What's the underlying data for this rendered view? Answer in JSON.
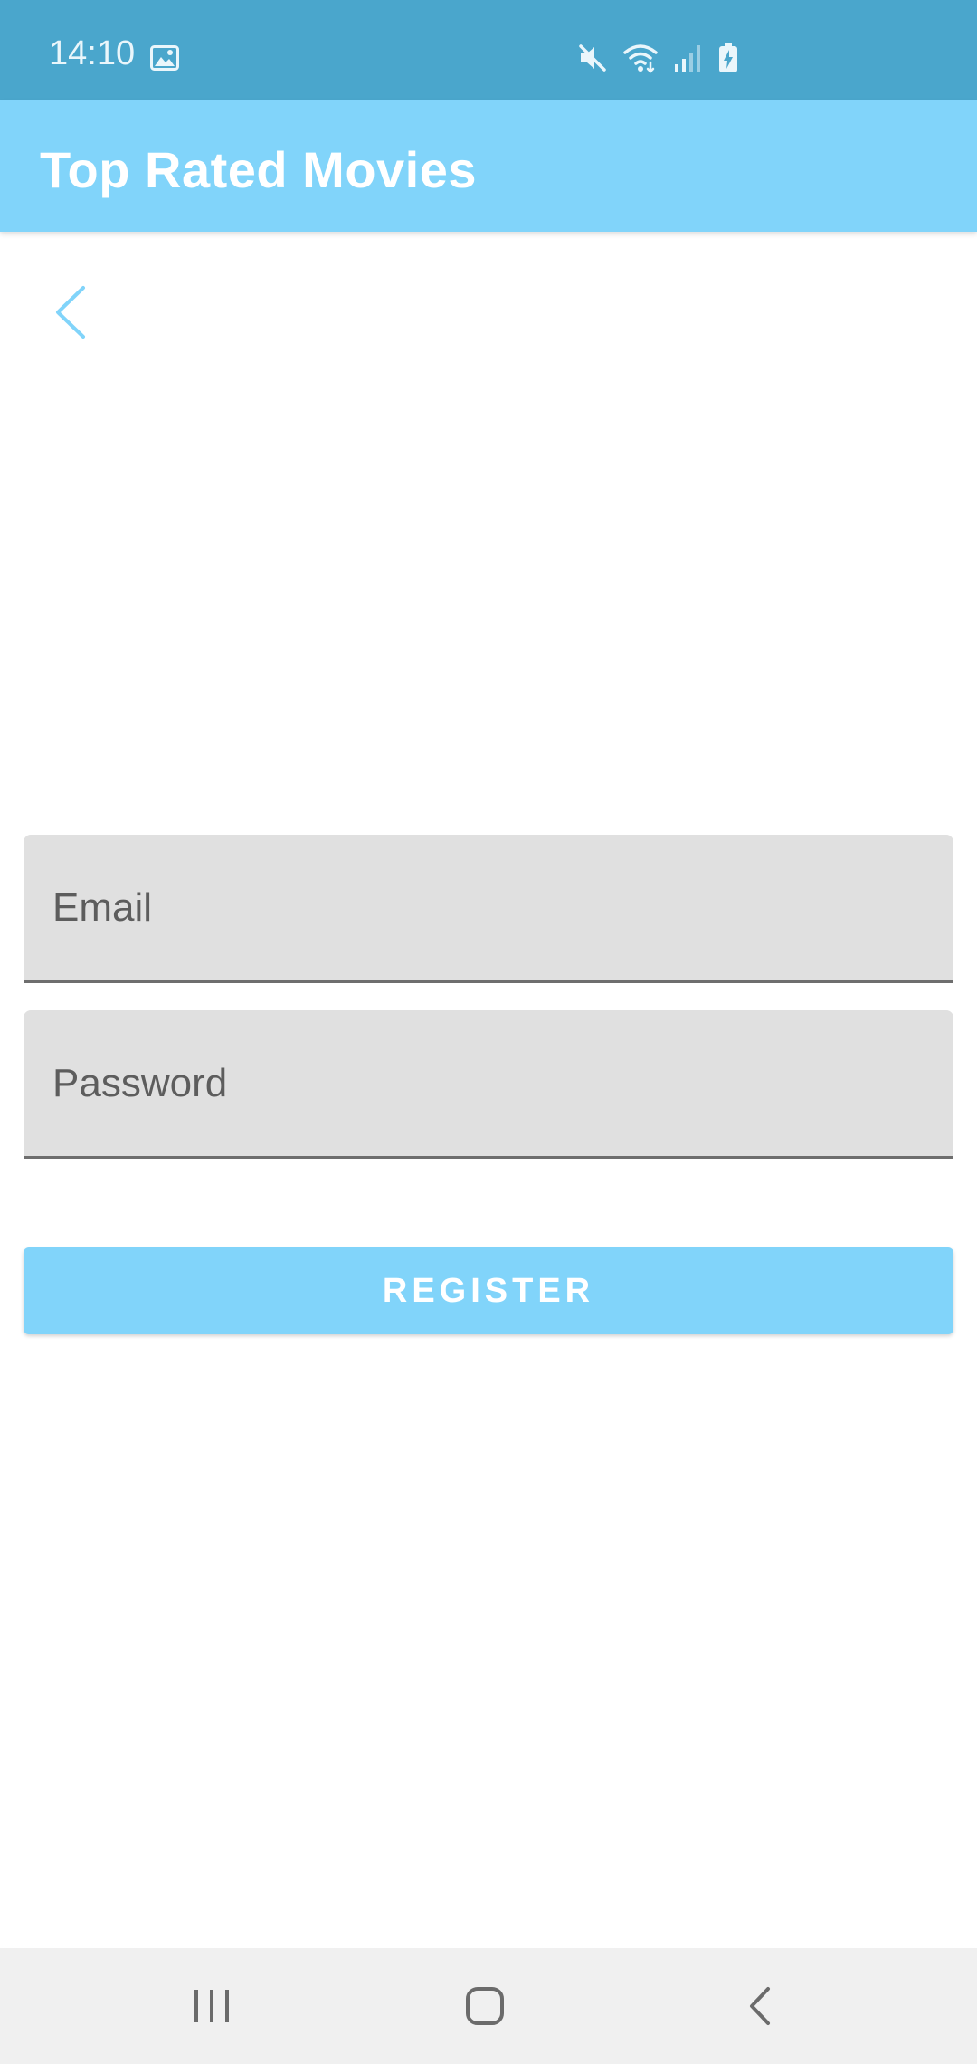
{
  "status_bar": {
    "time": "14:10",
    "icons": [
      "gallery-icon",
      "mute-icon",
      "wifi-icon",
      "signal-icon",
      "battery-charging-icon"
    ]
  },
  "app_bar": {
    "title": "Top Rated Movies"
  },
  "form": {
    "email_placeholder": "Email",
    "email_value": "",
    "password_placeholder": "Password",
    "password_value": "",
    "register_label": "REGISTER"
  },
  "nav_bar": {
    "buttons": [
      "recents",
      "home",
      "back"
    ]
  },
  "colors": {
    "status_bar": "#4aa6cc",
    "app_bar": "#81d4fa",
    "accent": "#81d4fa",
    "field_background": "#e0e0e0"
  }
}
